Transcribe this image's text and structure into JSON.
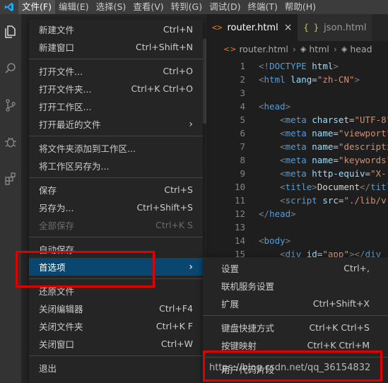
{
  "menubar": {
    "items": [
      {
        "label": "文件(F)",
        "active": true
      },
      {
        "label": "编辑(E)",
        "active": false
      },
      {
        "label": "选择(S)",
        "active": false
      },
      {
        "label": "查看(V)",
        "active": false
      },
      {
        "label": "转到(G)",
        "active": false
      },
      {
        "label": "调试(D)",
        "active": false
      },
      {
        "label": "终端(T)",
        "active": false
      },
      {
        "label": "帮助(H)",
        "active": false
      }
    ]
  },
  "activitybar": {
    "icons": [
      "files-icon",
      "search-icon",
      "source-control-icon",
      "debug-icon",
      "extensions-icon"
    ]
  },
  "tabs": [
    {
      "glyph": "<>",
      "label": "router.html",
      "close": "×",
      "active": true
    },
    {
      "glyph": "{ }",
      "label": "json.html",
      "close": "",
      "active": false
    }
  ],
  "breadcrumb": {
    "items": [
      "router.html",
      "html",
      "head"
    ]
  },
  "code_lines": [
    {
      "n": "1",
      "html": "<span class='t-gray'>&lt;!</span><span class='t-tag'>DOCTYPE</span> <span class='t-attr'>html</span><span class='t-gray'>&gt;</span>"
    },
    {
      "n": "2",
      "html": "<span class='t-gray'>&lt;</span><span class='t-tag'>html</span> <span class='t-attr'>lang</span>=<span class='t-str'>\"zh-CN\"</span><span class='t-gray'>&gt;</span>"
    },
    {
      "n": "3",
      "html": ""
    },
    {
      "n": "4",
      "html": "<span class='t-gray'>&lt;</span><span class='t-tag'>head</span><span class='t-gray'>&gt;</span>"
    },
    {
      "n": "5",
      "html": "    <span class='t-gray'>&lt;</span><span class='t-tag'>meta</span> <span class='t-attr'>charset</span>=<span class='t-str'>\"UTF-8\"</span>"
    },
    {
      "n": "6",
      "html": "    <span class='t-gray'>&lt;</span><span class='t-tag'>meta</span> <span class='t-attr'>name</span>=<span class='t-str'>\"viewport\"</span>"
    },
    {
      "n": "7",
      "html": "    <span class='t-gray'>&lt;</span><span class='t-tag'>meta</span> <span class='t-attr'>name</span>=<span class='t-str'>\"description\"</span>"
    },
    {
      "n": "8",
      "html": "    <span class='t-gray'>&lt;</span><span class='t-tag'>meta</span> <span class='t-attr'>name</span>=<span class='t-str'>\"keywords\"</span>"
    },
    {
      "n": "9",
      "html": "    <span class='t-gray'>&lt;</span><span class='t-tag'>meta</span> <span class='t-attr'>http-equiv</span>=<span class='t-str'>\"X-</span>"
    },
    {
      "n": "10",
      "html": "    <span class='t-gray'>&lt;</span><span class='t-tag'>title</span><span class='t-gray'>&gt;</span><span class='t-txt'>Document</span><span class='t-gray'>&lt;/</span><span class='t-tag'>title</span>"
    },
    {
      "n": "11",
      "html": "    <span class='t-gray'>&lt;</span><span class='t-tag'>script</span> <span class='t-attr'>src</span>=<span class='t-str'>\"./lib/v</span>"
    },
    {
      "n": "12",
      "html": "<span class='t-gray'>&lt;/</span><span class='t-tag'>head</span><span class='t-gray'>&gt;</span>"
    },
    {
      "n": "13",
      "html": ""
    },
    {
      "n": "14",
      "html": "<span class='t-gray'>&lt;</span><span class='t-tag'>body</span><span class='t-gray'>&gt;</span>"
    },
    {
      "n": "15",
      "html": "    <span class='t-gray'>&lt;</span><span class='t-tag'>div</span> <span class='t-attr'>id</span>=<span class='t-str'>\"app\"</span><span class='t-gray'>&gt;&lt;/</span><span class='t-tag'>div</span>"
    }
  ],
  "file_menu": {
    "items": [
      {
        "label": "新建文件",
        "shortcut": "Ctrl+N",
        "name": "menu-new-file",
        "disabled": false,
        "highlight": false,
        "arrow": false
      },
      {
        "label": "新建窗口",
        "shortcut": "Ctrl+Shift+N",
        "name": "menu-new-window",
        "disabled": false,
        "highlight": false,
        "arrow": false
      },
      {
        "sep": true
      },
      {
        "label": "打开文件...",
        "shortcut": "Ctrl+O",
        "name": "menu-open-file",
        "disabled": false,
        "highlight": false,
        "arrow": false
      },
      {
        "label": "打开文件夹...",
        "shortcut": "Ctrl+K Ctrl+O",
        "name": "menu-open-folder",
        "disabled": false,
        "highlight": false,
        "arrow": false
      },
      {
        "label": "打开工作区...",
        "shortcut": "",
        "name": "menu-open-workspace",
        "disabled": false,
        "highlight": false,
        "arrow": false
      },
      {
        "label": "打开最近的文件",
        "shortcut": "",
        "name": "menu-open-recent",
        "disabled": false,
        "highlight": false,
        "arrow": true
      },
      {
        "sep": true
      },
      {
        "label": "将文件夹添加到工作区...",
        "shortcut": "",
        "name": "menu-add-folder-to-workspace",
        "disabled": false,
        "highlight": false,
        "arrow": false
      },
      {
        "label": "将工作区另存为...",
        "shortcut": "",
        "name": "menu-save-workspace-as",
        "disabled": false,
        "highlight": false,
        "arrow": false
      },
      {
        "sep": true
      },
      {
        "label": "保存",
        "shortcut": "Ctrl+S",
        "name": "menu-save",
        "disabled": false,
        "highlight": false,
        "arrow": false
      },
      {
        "label": "另存为...",
        "shortcut": "Ctrl+Shift+S",
        "name": "menu-save-as",
        "disabled": false,
        "highlight": false,
        "arrow": false
      },
      {
        "label": "全部保存",
        "shortcut": "Ctrl+K S",
        "name": "menu-save-all",
        "disabled": true,
        "highlight": false,
        "arrow": false
      },
      {
        "sep": true
      },
      {
        "label": "自动保存",
        "shortcut": "",
        "name": "menu-auto-save",
        "disabled": false,
        "highlight": false,
        "arrow": false
      },
      {
        "label": "首选项",
        "shortcut": "",
        "name": "menu-preferences",
        "disabled": false,
        "highlight": true,
        "arrow": true
      },
      {
        "sep": true
      },
      {
        "label": "还原文件",
        "shortcut": "",
        "name": "menu-revert-file",
        "disabled": false,
        "highlight": false,
        "arrow": false
      },
      {
        "label": "关闭编辑器",
        "shortcut": "Ctrl+F4",
        "name": "menu-close-editor",
        "disabled": false,
        "highlight": false,
        "arrow": false
      },
      {
        "label": "关闭文件夹",
        "shortcut": "Ctrl+K F",
        "name": "menu-close-folder",
        "disabled": false,
        "highlight": false,
        "arrow": false
      },
      {
        "label": "关闭窗口",
        "shortcut": "Ctrl+W",
        "name": "menu-close-window",
        "disabled": false,
        "highlight": false,
        "arrow": false
      },
      {
        "sep": true
      },
      {
        "label": "退出",
        "shortcut": "",
        "name": "menu-exit",
        "disabled": false,
        "highlight": false,
        "arrow": false
      }
    ]
  },
  "prefs_submenu": {
    "items": [
      {
        "label": "设置",
        "shortcut": "Ctrl+,",
        "name": "submenu-settings"
      },
      {
        "label": "联机服务设置",
        "shortcut": "",
        "name": "submenu-online-services-settings"
      },
      {
        "label": "扩展",
        "shortcut": "Ctrl+Shift+X",
        "name": "submenu-extensions"
      },
      {
        "sep": true
      },
      {
        "label": "键盘快捷方式",
        "shortcut": "Ctrl+K Ctrl+S",
        "name": "submenu-keyboard-shortcuts"
      },
      {
        "label": "按键映射",
        "shortcut": "Ctrl+K Ctrl+M",
        "name": "submenu-keymaps"
      },
      {
        "sep": true
      },
      {
        "label": "用户代码片段",
        "shortcut": "",
        "name": "submenu-user-snippets"
      }
    ]
  },
  "watermark": "https://blog.csdn.net/qq_36154832",
  "colors": {
    "accent": "#007acc",
    "highlight": "#094771",
    "annotation_red": "#e00000"
  }
}
